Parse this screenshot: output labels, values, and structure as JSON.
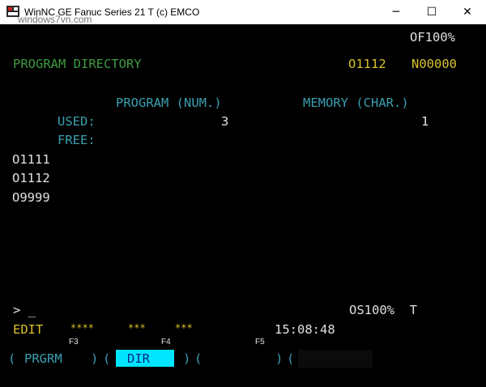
{
  "window": {
    "title": "WinNC GE Fanuc Series 21 T (c) EMCO",
    "watermark": "windows7vn.com",
    "minimize_glyph": "─",
    "maximize_glyph": "☐",
    "close_glyph": "✕"
  },
  "screen": {
    "override": "OF100%",
    "heading": "PROGRAM DIRECTORY",
    "program_number": "O1112",
    "block_number": "N00000",
    "column_program": "PROGRAM (NUM.)",
    "column_memory": "MEMORY (CHAR.)",
    "used_label": "USED:",
    "used_program": "3",
    "used_memory": "1",
    "free_label": "FREE:",
    "programs": [
      "O1111",
      "O1112",
      "O9999"
    ],
    "prompt": "> _",
    "spindle_status": "OS100%  T",
    "mode": "EDIT",
    "status_stars": [
      "****",
      "***",
      "***"
    ],
    "clock": "15:08:48"
  },
  "softkeys": {
    "f3": "F3",
    "f4": "F4",
    "f5": "F5",
    "prgrm": "PRGRM",
    "dir": "DIR",
    "open_paren": "(",
    "close_paren": ")"
  },
  "colors": {
    "background": "#000000",
    "heading": "#3e9a3e",
    "status": "#d8c12a",
    "labels": "#3a9fb0",
    "highlight": "#00e5ff"
  }
}
